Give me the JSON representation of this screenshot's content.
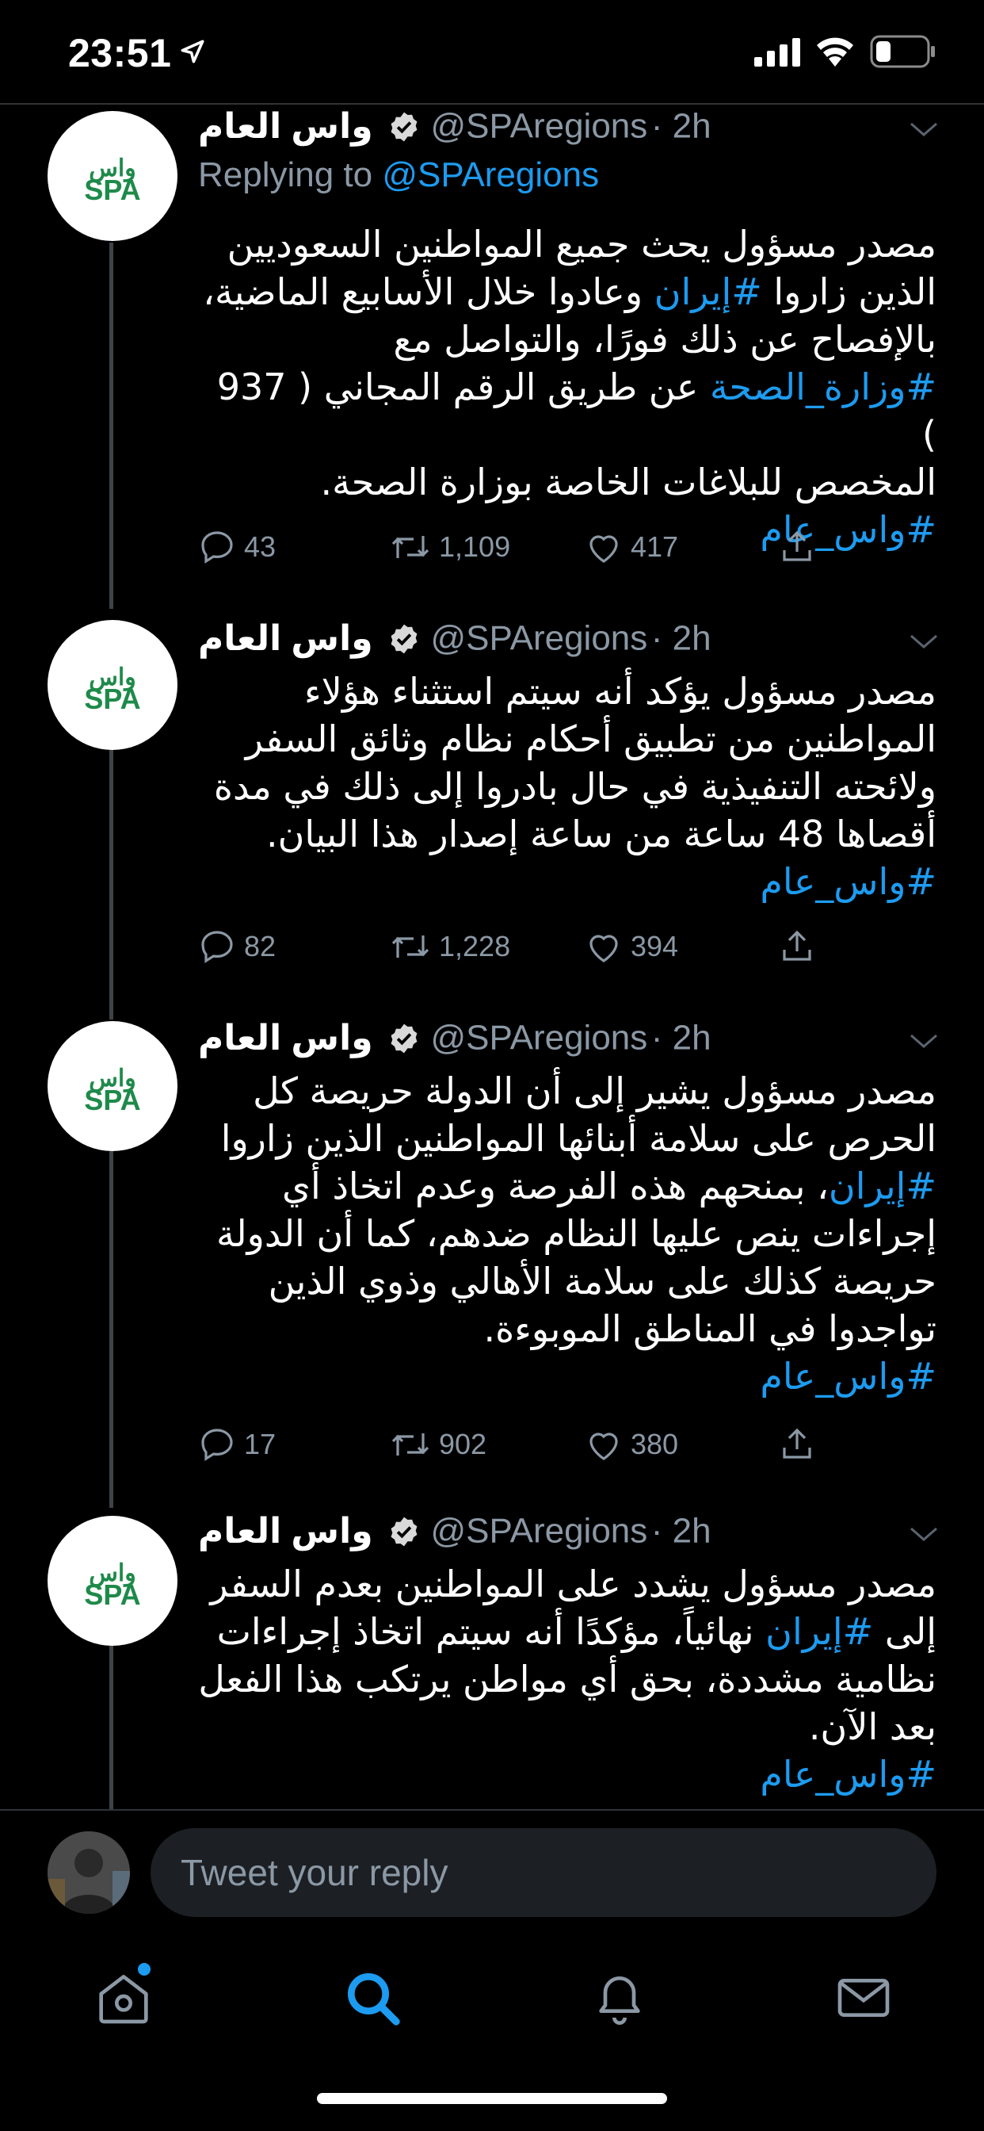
{
  "status_bar": {
    "time": "23:51"
  },
  "account": {
    "name": "واس العام",
    "handle": "@SPAregions",
    "time_ago": "2h",
    "avatar_logo_text": "SPA"
  },
  "tweets": [
    {
      "replying_prefix": "Replying to ",
      "replying_handle": "@SPAregions",
      "text_lines": [
        "مصدر مسؤول يحث جميع المواطنين السعوديين",
        "وعادوا خلال الأسابيع الماضية،",
        "بالإفصاح عن ذلك فورًا، والتواصل مع",
        "عن طريق الرقم المجاني ( 937 )",
        "المخصص للبلاغات الخاصة بوزارة الصحة."
      ],
      "line1_prefix": "الذين زاروا ",
      "hashtag_iran": "#إيران",
      "hashtag_moh": "#وزارة_الصحة",
      "hashtag_spa": "#واس_عام",
      "replies": "43",
      "retweets": "1,109",
      "likes": "417"
    },
    {
      "text_lines": [
        "مصدر مسؤول يؤكد أنه سيتم استثناء هؤلاء",
        "المواطنين من تطبيق أحكام نظام وثائق السفر",
        "ولائحته التنفيذية في حال بادروا إلى ذلك في مدة",
        "أقصاها 48 ساعة من ساعة إصدار هذا البيان."
      ],
      "hashtag_spa": "#واس_عام",
      "replies": "82",
      "retweets": "1,228",
      "likes": "394"
    },
    {
      "text_lines": [
        "مصدر مسؤول يشير إلى أن الدولة حريصة كل",
        "الحرص على سلامة أبنائها المواطنين الذين زاروا",
        "، بمنحهم هذه الفرصة وعدم اتخاذ أي",
        "إجراءات ينص عليها النظام ضدهم، كما أن الدولة",
        "حريصة كذلك على سلامة الأهالي وذوي الذين",
        "تواجدوا في المناطق الموبوءة."
      ],
      "hashtag_iran": "#إيران",
      "hashtag_spa": "#واس_عام",
      "replies": "17",
      "retweets": "902",
      "likes": "380"
    },
    {
      "text_lines": [
        "مصدر مسؤول يشدد على المواطنين بعدم السفر",
        "إلى ",
        " نهائياً، مؤكدًا أنه سيتم اتخاذ إجراءات",
        "نظامية مشددة، بحق أي مواطن يرتكب هذا الفعل",
        "بعد الآن."
      ],
      "hashtag_iran": "#إيران",
      "hashtag_spa": "#واس_عام"
    }
  ],
  "composer": {
    "placeholder": "Tweet your reply"
  },
  "tabbar": {
    "items": [
      "home-icon",
      "search-icon",
      "notifications-icon",
      "messages-icon"
    ],
    "active": "search-icon"
  },
  "colors": {
    "accent": "#1d9bf0",
    "background": "#000000",
    "muted": "#8b98a5",
    "logo_green": "#1e8a4a"
  }
}
